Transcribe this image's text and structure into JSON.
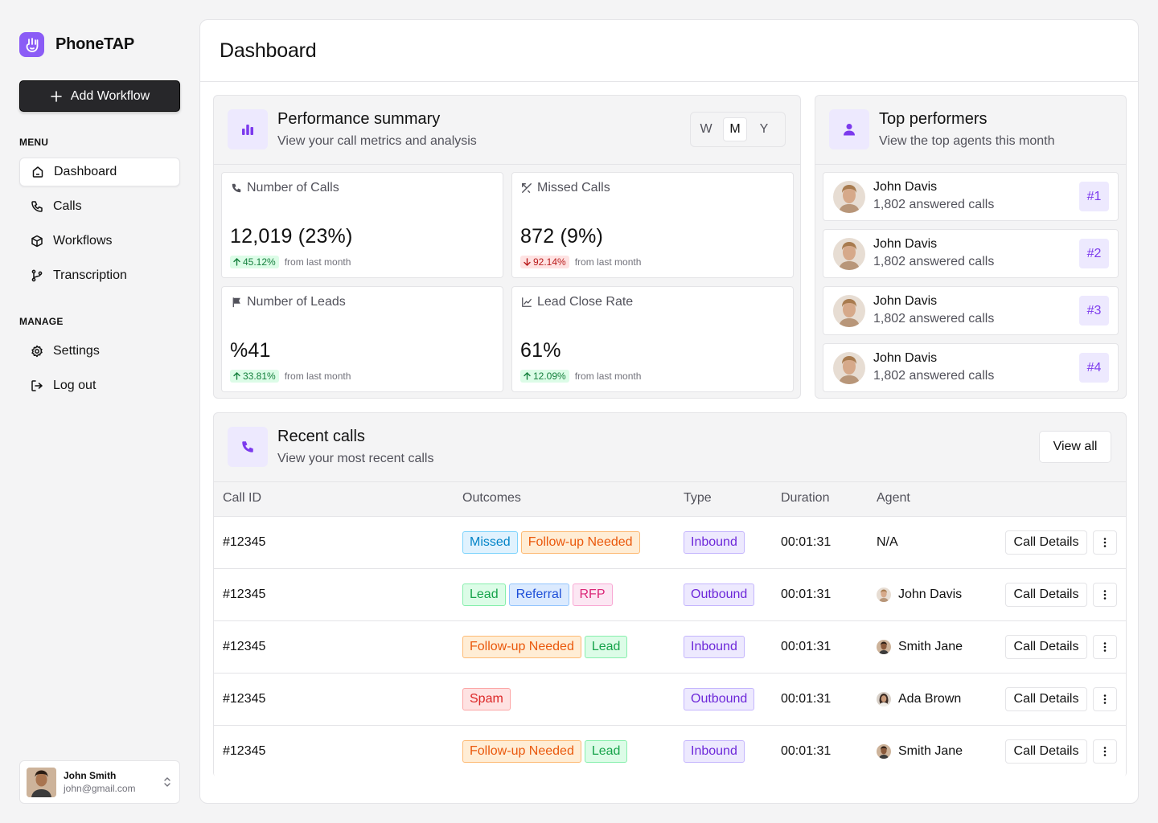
{
  "app": {
    "name": "PhoneTAP"
  },
  "sidebar": {
    "add_workflow": "Add Workflow",
    "menu_label": "MENU",
    "menu_items": [
      {
        "label": "Dashboard",
        "icon": "home-icon",
        "active": true
      },
      {
        "label": "Calls",
        "icon": "phone-icon"
      },
      {
        "label": "Workflows",
        "icon": "box-icon"
      },
      {
        "label": "Transcription",
        "icon": "git-branch-icon"
      }
    ],
    "manage_label": "MANAGE",
    "manage_items": [
      {
        "label": "Settings",
        "icon": "gear-icon"
      },
      {
        "label": "Log out",
        "icon": "logout-icon"
      }
    ],
    "user": {
      "name": "John Smith",
      "email": "john@gmail.com"
    }
  },
  "header": {
    "title": "Dashboard"
  },
  "performance": {
    "title": "Performance summary",
    "subtitle": "View your call metrics and analysis",
    "periods": [
      "W",
      "M",
      "Y"
    ],
    "active_period": "M",
    "metrics": [
      {
        "label": "Number of Calls",
        "icon": "phone-icon",
        "value": "12,019 (23%)",
        "delta": "45.12%",
        "direction": "up",
        "note": "from last month"
      },
      {
        "label": "Missed Calls",
        "icon": "phone-missed-icon",
        "value": "872 (9%)",
        "delta": "92.14%",
        "direction": "down",
        "note": "from last month"
      },
      {
        "label": "Number of Leads",
        "icon": "flag-icon",
        "value": "%41",
        "delta": "33.81%",
        "direction": "up",
        "note": "from last month"
      },
      {
        "label": "Lead Close Rate",
        "icon": "trend-icon",
        "value": "61%",
        "delta": "12.09%",
        "direction": "up",
        "note": "from last month"
      }
    ]
  },
  "top_performers": {
    "title": "Top performers",
    "subtitle": "View the top agents this month",
    "items": [
      {
        "name": "John Davis",
        "calls": "1,802 answered calls",
        "rank": "#1"
      },
      {
        "name": "John Davis",
        "calls": "1,802 answered calls",
        "rank": "#2"
      },
      {
        "name": "John Davis",
        "calls": "1,802 answered calls",
        "rank": "#3"
      },
      {
        "name": "John Davis",
        "calls": "1,802 answered calls",
        "rank": "#4"
      }
    ]
  },
  "recent_calls": {
    "title": "Recent calls",
    "subtitle": "View your most recent calls",
    "view_all": "View all",
    "columns": [
      "Call ID",
      "Outcomes",
      "Type",
      "Duration",
      "Agent"
    ],
    "details_label": "Call Details",
    "rows": [
      {
        "id": "#12345",
        "outcomes": [
          {
            "label": "Missed",
            "kind": "missed"
          },
          {
            "label": "Follow-up Needed",
            "kind": "follow"
          }
        ],
        "type": "Inbound",
        "duration": "00:01:31",
        "agent": "N/A",
        "avatar": false
      },
      {
        "id": "#12345",
        "outcomes": [
          {
            "label": "Lead",
            "kind": "lead"
          },
          {
            "label": "Referral",
            "kind": "referral"
          },
          {
            "label": "RFP",
            "kind": "rfp"
          }
        ],
        "type": "Outbound",
        "duration": "00:01:31",
        "agent": "John Davis",
        "avatar": true
      },
      {
        "id": "#12345",
        "outcomes": [
          {
            "label": "Follow-up Needed",
            "kind": "follow"
          },
          {
            "label": "Lead",
            "kind": "lead"
          }
        ],
        "type": "Inbound",
        "duration": "00:01:31",
        "agent": "Smith Jane",
        "avatar": true
      },
      {
        "id": "#12345",
        "outcomes": [
          {
            "label": "Spam",
            "kind": "spam"
          }
        ],
        "type": "Outbound",
        "duration": "00:01:31",
        "agent": "Ada Brown",
        "avatar": true
      },
      {
        "id": "#12345",
        "outcomes": [
          {
            "label": "Follow-up Needed",
            "kind": "follow"
          },
          {
            "label": "Lead",
            "kind": "lead"
          }
        ],
        "type": "Inbound",
        "duration": "00:01:31",
        "agent": "Smith Jane",
        "avatar": true
      }
    ]
  },
  "colors": {
    "accent": "#8b5cf6",
    "accent_soft": "#ede9fe",
    "dark_button": "#27272a"
  }
}
